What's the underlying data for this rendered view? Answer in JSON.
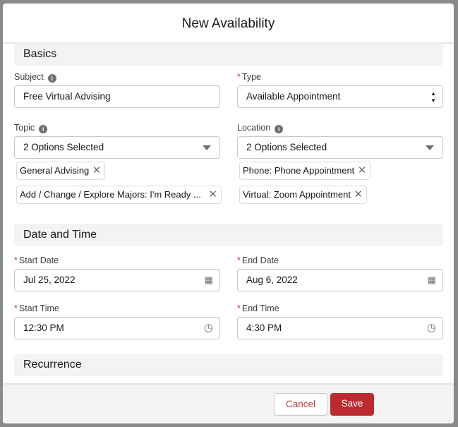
{
  "title": "New Availability",
  "sections": {
    "basics": "Basics",
    "datetime": "Date and Time",
    "recurrence": "Recurrence"
  },
  "fields": {
    "subject": {
      "label": "Subject",
      "value": "Free Virtual Advising"
    },
    "type": {
      "label": "Type",
      "value": "Available Appointment"
    },
    "topic": {
      "label": "Topic",
      "value": "2 Options Selected",
      "pills": [
        "General Advising",
        "Add / Change / Explore Majors: I'm Ready ..."
      ]
    },
    "location": {
      "label": "Location",
      "value": "2 Options Selected",
      "pills": [
        "Phone: Phone Appointment",
        "Virtual: Zoom Appointment"
      ]
    },
    "start_date": {
      "label": "Start Date",
      "value": "Jul 25, 2022"
    },
    "end_date": {
      "label": "End Date",
      "value": "Aug 6, 2022"
    },
    "start_time": {
      "label": "Start Time",
      "value": "12:30 PM"
    },
    "end_time": {
      "label": "End Time",
      "value": "4:30 PM"
    }
  },
  "footer": {
    "cancel": "Cancel",
    "save": "Save"
  },
  "colors": {
    "accent": "#ba2a2f",
    "required": "#c23934"
  }
}
